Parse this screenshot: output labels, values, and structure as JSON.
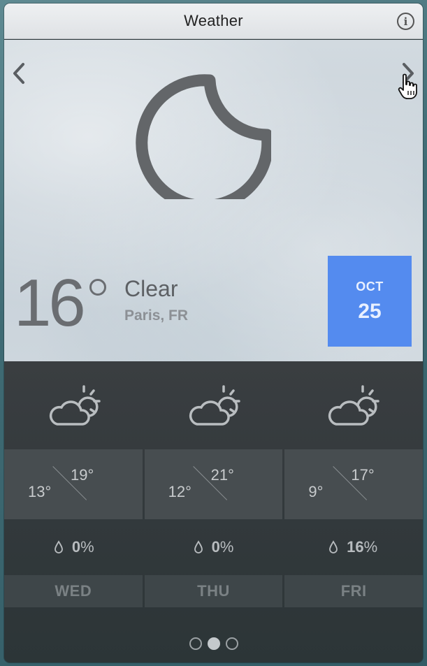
{
  "window": {
    "title": "Weather"
  },
  "current": {
    "temperature": "16",
    "condition": "Clear",
    "location": "Paris, FR",
    "date": {
      "month": "OCT",
      "day": "25"
    },
    "icon": "moon-icon"
  },
  "forecast": [
    {
      "day": "WED",
      "high": "19°",
      "low": "13°",
      "precip": "0",
      "icon": "partly-cloudy-icon"
    },
    {
      "day": "THU",
      "high": "21°",
      "low": "12°",
      "precip": "0",
      "icon": "partly-cloudy-icon"
    },
    {
      "day": "FRI",
      "high": "17°",
      "low": "9°",
      "precip": "16",
      "icon": "partly-cloudy-icon"
    }
  ],
  "precip_unit": "%",
  "pagination": {
    "count": 3,
    "active": 2
  },
  "colors": {
    "accent": "#548bef",
    "forecast_bg": "#343a3d"
  }
}
